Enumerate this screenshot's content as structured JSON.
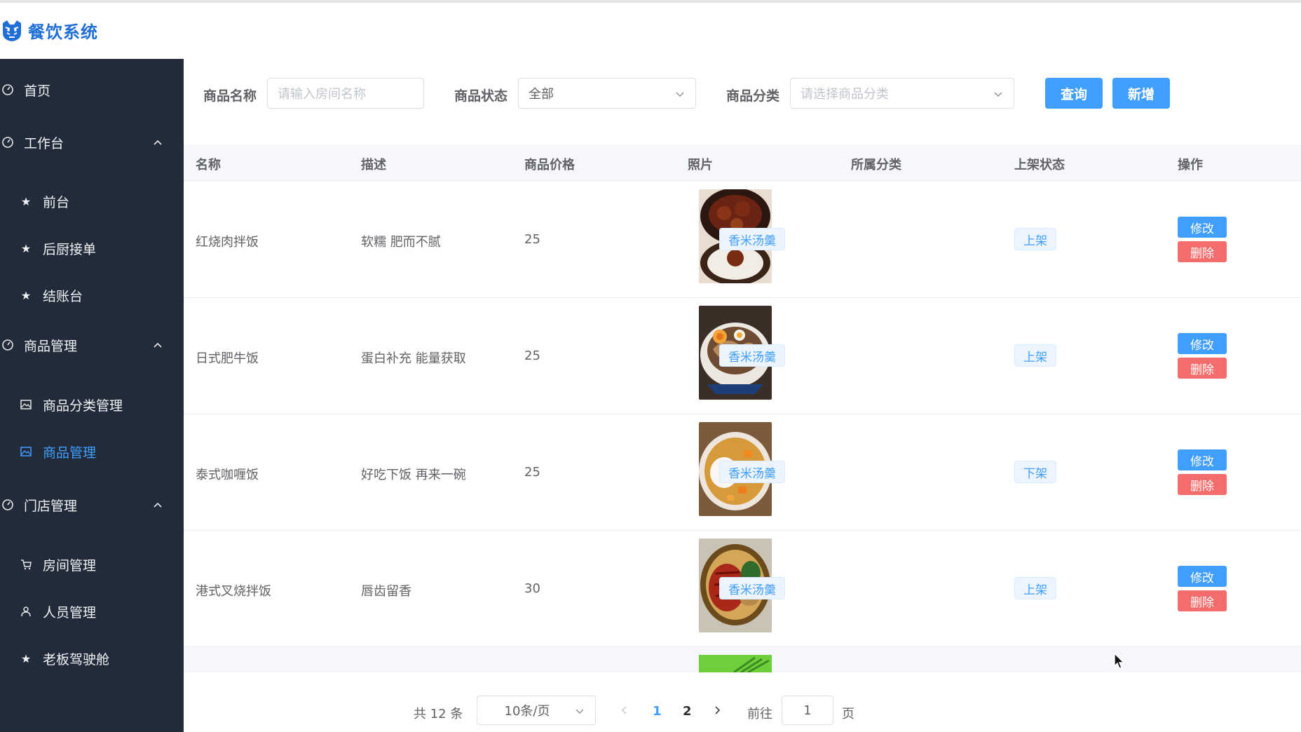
{
  "app": {
    "title": "餐饮系统",
    "logo_icon": "tiger-logo-icon"
  },
  "sidebar": {
    "items": [
      {
        "label": "首页",
        "icon": "dashboard-icon"
      },
      {
        "label": "工作台",
        "icon": "dashboard-icon",
        "expanded": true
      },
      {
        "label": "前台",
        "icon": "star-icon"
      },
      {
        "label": "后厨接单",
        "icon": "star-icon"
      },
      {
        "label": "结账台",
        "icon": "star-icon"
      },
      {
        "label": "商品管理",
        "icon": "dashboard-icon",
        "expanded": true
      },
      {
        "label": "商品分类管理",
        "icon": "picture-icon"
      },
      {
        "label": "商品管理",
        "icon": "picture-icon",
        "active": true
      },
      {
        "label": "门店管理",
        "icon": "dashboard-icon",
        "expanded": true
      },
      {
        "label": "房间管理",
        "icon": "cart-icon"
      },
      {
        "label": "人员管理",
        "icon": "user-icon"
      },
      {
        "label": "老板驾驶舱",
        "icon": "star-icon"
      }
    ]
  },
  "filters": {
    "name_label": "商品名称",
    "name_placeholder": "请输入房间名称",
    "status_label": "商品状态",
    "status_value": "全部",
    "category_label": "商品分类",
    "category_placeholder": "请选择商品分类",
    "query_button": "查询",
    "add_button": "新增"
  },
  "table": {
    "columns": [
      "名称",
      "描述",
      "商品价格",
      "照片",
      "所属分类",
      "上架状态",
      "操作"
    ],
    "rows": [
      {
        "name": "红烧肉拌饭",
        "desc": "软糯 肥而不腻",
        "price": "25",
        "category": "香米汤羹",
        "status": "上架",
        "edit": "修改",
        "delete": "删除"
      },
      {
        "name": "日式肥牛饭",
        "desc": "蛋白补充 能量获取",
        "price": "25",
        "category": "香米汤羹",
        "status": "上架",
        "edit": "修改",
        "delete": "删除"
      },
      {
        "name": "泰式咖喱饭",
        "desc": "好吃下饭 再来一碗",
        "price": "25",
        "category": "香米汤羹",
        "status": "下架",
        "edit": "修改",
        "delete": "删除"
      },
      {
        "name": "港式叉烧拌饭",
        "desc": "唇齿留香",
        "price": "30",
        "category": "香米汤羹",
        "status": "上架",
        "edit": "修改",
        "delete": "删除"
      }
    ]
  },
  "pagination": {
    "total": "共 12 条",
    "page_size": "10条/页",
    "pages": [
      "1",
      "2"
    ],
    "current_page": "1",
    "goto_label": "前往",
    "goto_value": "1",
    "page_suffix": "页"
  },
  "colors": {
    "primary": "#409eff",
    "danger": "#f56c6c",
    "sidebar": "#222b3a"
  }
}
